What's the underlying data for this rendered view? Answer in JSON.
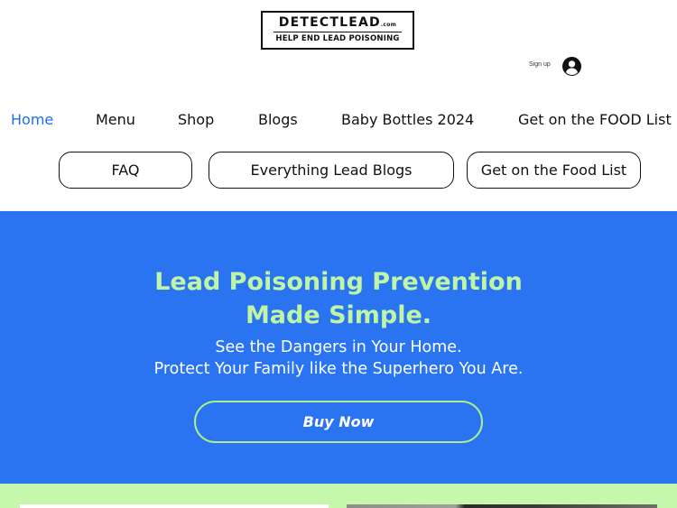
{
  "header": {
    "logo_main": "DETECTLEAD",
    "logo_com": ".com",
    "logo_tagline": "HELP END LEAD POISONING",
    "signup_label": "Sign up",
    "avatar_icon": "user-circle-icon"
  },
  "nav": {
    "items": [
      {
        "label": "Home",
        "active": true
      },
      {
        "label": "Menu"
      },
      {
        "label": "Shop"
      },
      {
        "label": "Blogs"
      },
      {
        "label": "Baby Bottles 2024"
      },
      {
        "label": "Get on the FOOD List"
      }
    ],
    "active_color": "#1e6ef2"
  },
  "pills": [
    {
      "label": "FAQ"
    },
    {
      "label": "Everything Lead Blogs"
    },
    {
      "label": "Get on the Food List"
    }
  ],
  "hero": {
    "title_line1": "Lead Poisoning Prevention",
    "title_line2": "Made Simple.",
    "sub_line1": "See the Dangers in Your Home.",
    "sub_line2": "Protect Your Family like the Superhero You Are.",
    "button_label": "Buy Now",
    "background_color": "#2a74f2",
    "title_color": "#bff5a4",
    "button_border_color": "#a9f08a"
  },
  "band": {
    "background_color": "#c5f7ad"
  }
}
